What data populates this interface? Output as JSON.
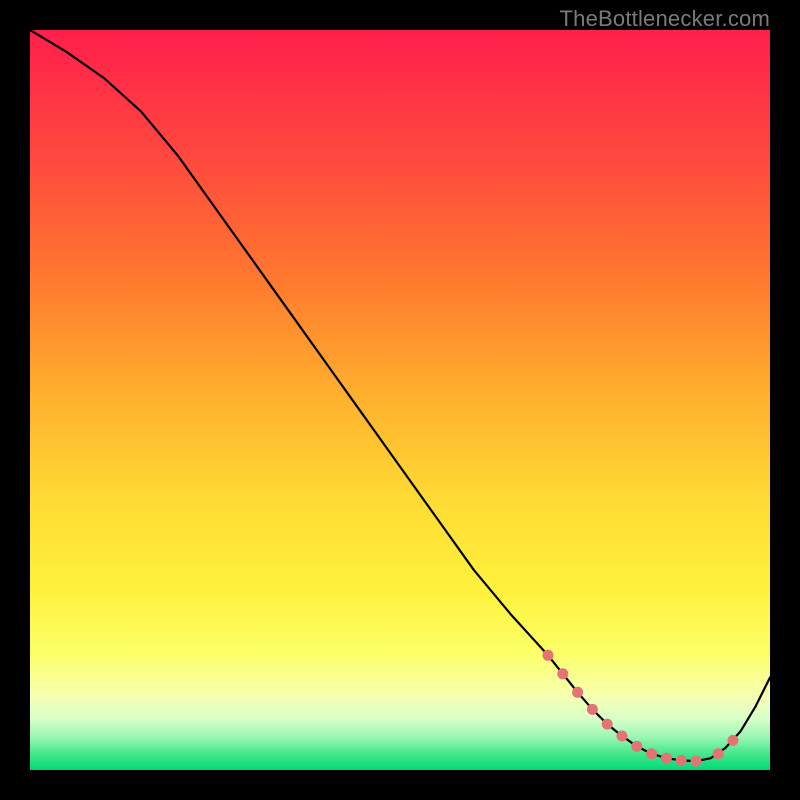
{
  "watermark": "TheBottlenecker.com",
  "colors": {
    "gradient_top": "#ff1f4b",
    "gradient_mid1": "#ff6a2e",
    "gradient_mid2": "#ffb92e",
    "gradient_mid3": "#ffe63a",
    "gradient_mid4": "#f5ff6a",
    "gradient_low_yellow": "#faffc0",
    "gradient_bottom": "#00e676",
    "curve": "#000000",
    "dot": "#e57373",
    "bg": "#000000"
  },
  "chart_data": {
    "type": "line",
    "title": "",
    "xlabel": "",
    "ylabel": "",
    "xlim": [
      0,
      100
    ],
    "ylim": [
      0,
      100
    ],
    "series": [
      {
        "name": "bottleneck-curve",
        "x": [
          0,
          5,
          10,
          15,
          20,
          25,
          30,
          35,
          40,
          45,
          50,
          55,
          60,
          65,
          70,
          72,
          74,
          76,
          78,
          80,
          82,
          84,
          86,
          88,
          90,
          92,
          94,
          96,
          98,
          100
        ],
        "y": [
          100,
          97,
          93.5,
          89,
          83,
          76,
          69,
          62,
          55,
          48,
          41,
          34,
          27,
          21,
          15.5,
          13,
          10.5,
          8.2,
          6.2,
          4.6,
          3.2,
          2.2,
          1.6,
          1.3,
          1.2,
          1.6,
          3.0,
          5.2,
          8.5,
          12.5
        ]
      }
    ],
    "dots": {
      "name": "highlighted-points",
      "x": [
        70,
        72,
        74,
        76,
        78,
        80,
        82,
        84,
        86,
        88,
        90,
        93,
        95
      ],
      "y": [
        15.5,
        13,
        10.5,
        8.2,
        6.2,
        4.6,
        3.2,
        2.2,
        1.6,
        1.3,
        1.2,
        2.2,
        4.0
      ]
    }
  }
}
